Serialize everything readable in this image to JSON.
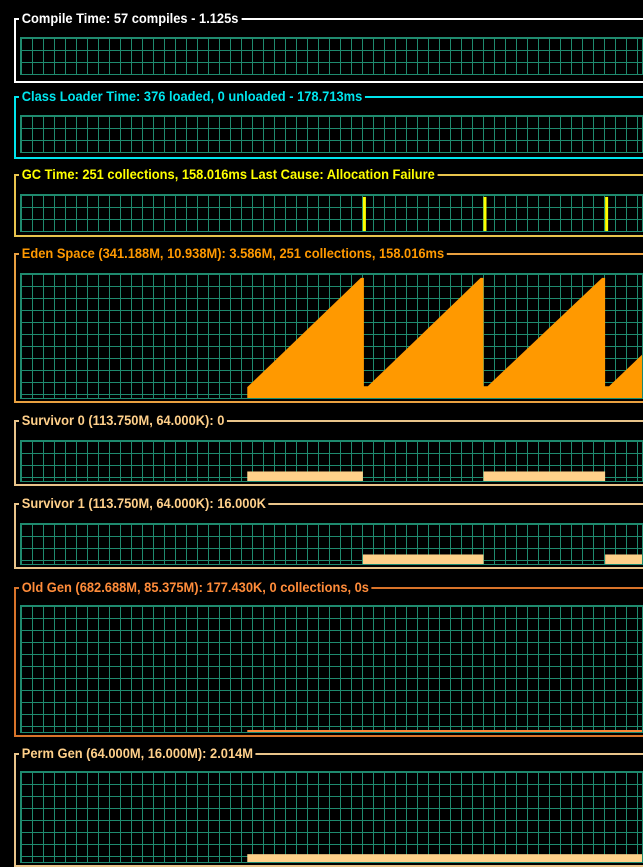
{
  "colors": {
    "background": "#000000",
    "grid": "#1f8a6e",
    "white": "#ffffff",
    "cyan": "#00e5ee",
    "yellow": "#ffff00",
    "gold": "#e8c44c",
    "orange": "#ff9900",
    "tan": "#ffd08a",
    "old_gen": "#ff8c3a",
    "perm": "#ffd08a"
  },
  "panels": {
    "compile": {
      "title": "Compile Time: 57 compiles - 1.125s"
    },
    "classloader": {
      "title": "Class Loader Time: 376 loaded, 0 unloaded - 178.713ms"
    },
    "gc": {
      "title": "GC Time: 251 collections, 158.016ms Last Cause: Allocation Failure"
    },
    "eden": {
      "title": "Eden Space (341.188M, 10.938M): 3.586M, 251 collections, 158.016ms"
    },
    "survivor0": {
      "title": "Survivor 0 (113.750M, 64.000K): 0"
    },
    "survivor1": {
      "title": "Survivor 1 (113.750M, 64.000K): 16.000K"
    },
    "oldgen": {
      "title": "Old Gen (682.688M, 85.375M): 177.430K, 0 collections, 0s"
    },
    "permgen": {
      "title": "Perm Gen (64.000M, 16.000M): 2.014M"
    }
  }
}
